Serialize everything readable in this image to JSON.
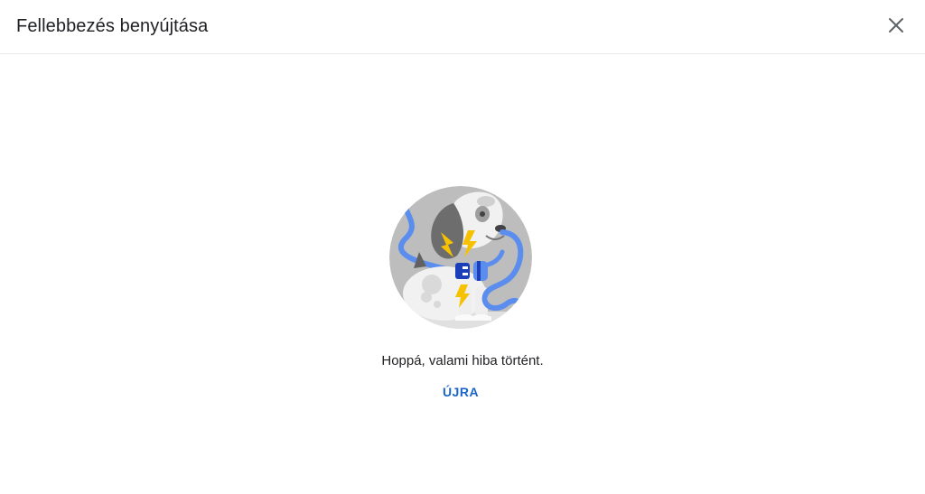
{
  "dialog": {
    "title": "Fellebbezés benyújtása",
    "close_icon": "close-icon"
  },
  "error": {
    "illustration": "unplugged-dog-illustration",
    "message": "Hoppá, valami hiba történt.",
    "retry_label": "ÚJRA"
  },
  "colors": {
    "accent": "#1a64c8",
    "cable": "#5b8def",
    "bolt": "#f6c200",
    "circle_bg": "#bdbdbd"
  }
}
